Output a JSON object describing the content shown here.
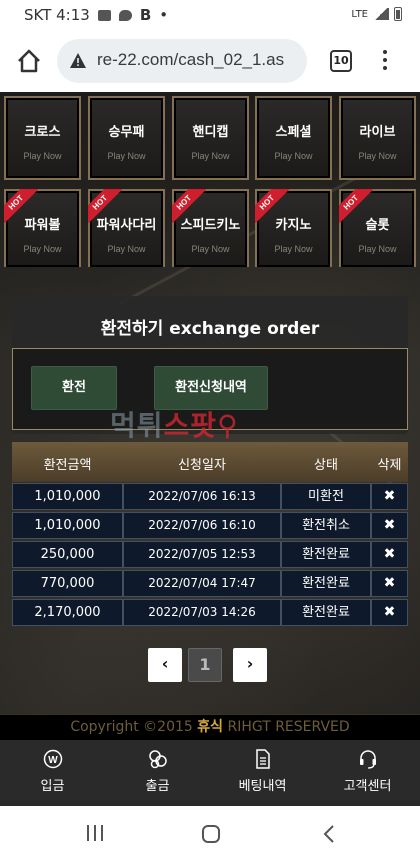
{
  "status_bar": {
    "carrier_time": "SKT 4:13",
    "network": "LTE"
  },
  "browser": {
    "url": "re-22.com/cash_02_1.as",
    "tab_count": "10"
  },
  "games_row1": [
    {
      "name": "크로스",
      "play": "Play Now"
    },
    {
      "name": "승무패",
      "play": "Play Now"
    },
    {
      "name": "핸디캡",
      "play": "Play Now"
    },
    {
      "name": "스페셜",
      "play": "Play Now"
    },
    {
      "name": "라이브",
      "play": "Play Now"
    }
  ],
  "games_row2": [
    {
      "name": "파워볼",
      "play": "Play Now",
      "badge": "HOT"
    },
    {
      "name": "파워사다리",
      "play": "Play Now",
      "badge": "HOT"
    },
    {
      "name": "스피드키노",
      "play": "Play Now",
      "badge": "HOT"
    },
    {
      "name": "카지노",
      "play": "Play Now",
      "badge": "HOT"
    },
    {
      "name": "슬롯",
      "play": "Play Now",
      "badge": "HOT"
    }
  ],
  "exchange": {
    "title": "환전하기 exchange order",
    "btn_exchange": "환전",
    "btn_history": "환전신청내역"
  },
  "watermark": {
    "part1": "먹튀",
    "part2": "스팟"
  },
  "table": {
    "headers": [
      "환전금액",
      "신청일자",
      "상태",
      "삭제"
    ],
    "rows": [
      {
        "amount": "1,010,000",
        "date": "2022/07/06 16:13",
        "status": "미환전",
        "del": "✖"
      },
      {
        "amount": "1,010,000",
        "date": "2022/07/06 16:10",
        "status": "환전취소",
        "del": "✖"
      },
      {
        "amount": "250,000",
        "date": "2022/07/05 12:53",
        "status": "환전완료",
        "del": "✖"
      },
      {
        "amount": "770,000",
        "date": "2022/07/04 17:47",
        "status": "환전완료",
        "del": "✖"
      },
      {
        "amount": "2,170,000",
        "date": "2022/07/03 14:26",
        "status": "환전완료",
        "del": "✖"
      }
    ]
  },
  "pagination": {
    "prev": "‹",
    "current": "1",
    "next": "›"
  },
  "footer": {
    "copy_prefix": "Copyright ©2015 ",
    "brand": "휴식",
    "copy_suffix": " RIHGT RESERVED"
  },
  "bottom_nav": [
    {
      "label": "입금",
      "icon": "deposit-coin-icon"
    },
    {
      "label": "출금",
      "icon": "withdraw-coins-icon"
    },
    {
      "label": "베팅내역",
      "icon": "document-list-icon"
    },
    {
      "label": "고객센터",
      "icon": "headset-icon"
    }
  ],
  "colors": {
    "accent_gold": "#d7a93a",
    "button_green": "#2f4a35",
    "hot_red": "#cf1f2e",
    "table_cell": "#0e1a2c"
  }
}
